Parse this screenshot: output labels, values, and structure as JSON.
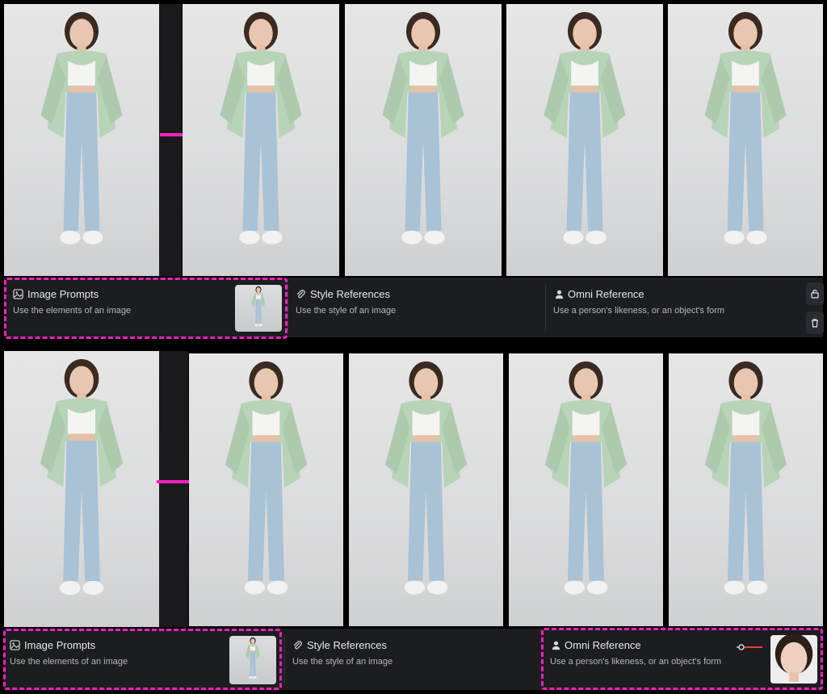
{
  "top_row": {
    "reference_panel": {
      "image_prompts": {
        "title": "Image Prompts",
        "description": "Use the elements of an image"
      },
      "style_references": {
        "title": "Style References",
        "description": "Use the style of an image"
      },
      "omni_reference": {
        "title": "Omni Reference",
        "description": "Use a person's likeness, or an object's form"
      },
      "side_buttons": [
        "unlock-icon",
        "trash-icon"
      ]
    }
  },
  "bottom_row": {
    "reference_panel": {
      "image_prompts": {
        "title": "Image Prompts",
        "description": "Use the elements of an image"
      },
      "style_references": {
        "title": "Style References",
        "description": "Use the style of an image"
      },
      "omni_reference": {
        "title": "Omni Reference",
        "description": "Use a person's likeness, or an object's form"
      }
    }
  },
  "colors": {
    "highlight": "#ff1fbf",
    "panel_bg": "#1c1d20",
    "cardigan": "#b7d3b8",
    "jeans": "#a9c2d6",
    "top": "#f4f4f2",
    "slider_accent": "#e0453a"
  },
  "icons": [
    "image-icon",
    "paperclip-icon",
    "person-icon",
    "unlock-icon",
    "trash-icon",
    "arrow-right-icon"
  ]
}
